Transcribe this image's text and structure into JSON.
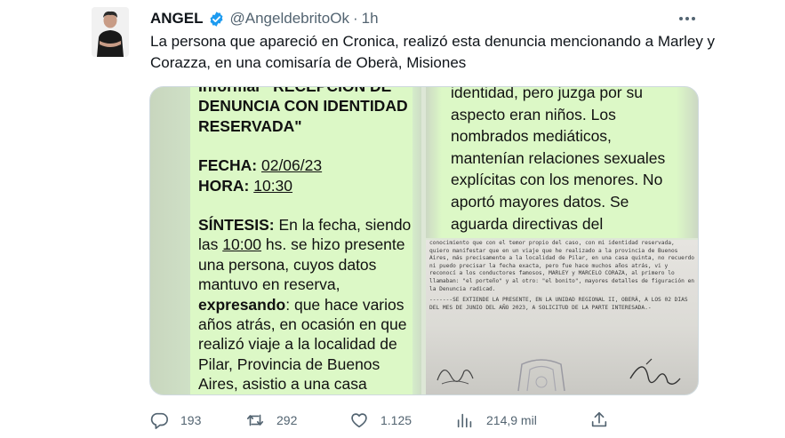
{
  "author": {
    "display_name": "ANGEL",
    "handle": "@AngeldebritoOk",
    "separator": "·",
    "time": "1h"
  },
  "tweet": {
    "text": "La persona que apareció en Cronica, realizó esta denuncia mencionando a Marley y Corazza, en una comisaría de Oberà, Misiones"
  },
  "media": {
    "left_panel": {
      "line1": "Informar \"RECEPCION DE",
      "line2": "DENUNCIA CON IDENTIDAD",
      "line3": "RESERVADA\"",
      "fecha_label": "FECHA:",
      "fecha_value": "02/06/23",
      "hora_label": "HORA:",
      "hora_value": "10:30",
      "sintesis_label": "SÍNTESIS:",
      "sintesis_text1": " En la fecha, siendo",
      "sintesis_text2a": "las ",
      "sintesis_time": "10:00",
      "sintesis_text2b": " hs. se hizo presente",
      "sintesis_text3": "una persona, cuyos datos",
      "sintesis_text4": "mantuvo en reserva,",
      "expresando_label": "expresando",
      "expresando_text": ": que hace varios",
      "line_a": "años atrás,  en ocasión en que",
      "line_b": "realizó viaje  a la localidad de",
      "line_c": "Pilar, Provincia de Buenos",
      "line_d": "Aires, asistio a una casa"
    },
    "right_top_panel": {
      "line1": "identidad, pero juzga por su",
      "line2": "aspecto eran niños. Los",
      "line3": "nombrados mediáticos,",
      "line4": "mantenían relaciones sexuales",
      "line5": "explícitas con los menores. No",
      "line6": "aportó mayores  datos. Se",
      "line7": "aguarda directivas del"
    },
    "right_bottom_panel": {
      "para1": "conocimiento que con el temor propio del caso, con mi identidad reservada, quiero manifestar que en un viaje que he realizado a la provincia de Buenos Aires, más precisamente a la localidad de Pilar, en una casa quinta, no recuerdo ni puedo precisar la fecha exacta, pero fue hace muchos años atrás, vi y reconocí a los conductores famosos, MARLEY y MARCELO CORAZA, al primero lo llamaban: \"el porteño\" y al otro: \"el bonito\", mayores detalles de figuración en la Denuncia radicad.",
      "para2": "-------SE EXTIENDE LA PRESENTE, EN LA UNIDAD REGIONAL II, OBERÁ, A LOS 02 DIAS DEL MES DE JUNIO DEL AÑO 2023, A SOLICITUD DE LA PARTE INTERESADA.-"
    }
  },
  "metrics": {
    "replies": "193",
    "retweets": "292",
    "likes": "1.125",
    "views": "214,9 mil"
  },
  "colors": {
    "verified": "#1d9bf0",
    "secondary_text": "#536471",
    "chat_bubble": "#dcf8c6"
  },
  "icons": [
    "verified-badge-icon",
    "more-icon",
    "reply-icon",
    "retweet-icon",
    "like-icon",
    "views-icon",
    "share-icon"
  ]
}
